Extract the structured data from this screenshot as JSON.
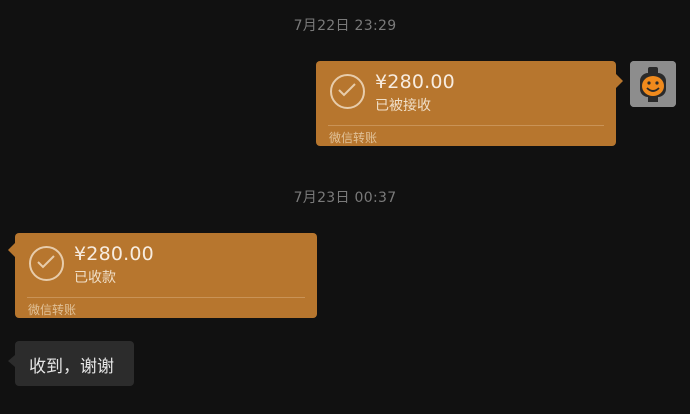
{
  "chat": {
    "timestamp_1": "7月22日 23:29",
    "timestamp_2": "7月23日 00:37",
    "sent_transfer": {
      "amount": "¥280.00",
      "status": "已被接收",
      "footer": "微信转账"
    },
    "received_transfer": {
      "amount": "¥280.00",
      "status": "已收款",
      "footer": "微信转账"
    },
    "text_message": "收到，谢谢"
  },
  "colors": {
    "background": "#111111",
    "transfer_bubble": "#b7762e",
    "text_bubble": "#2c2c2c"
  },
  "icons": {
    "check": "check-circle-icon",
    "avatar": "pumpkin-avatar"
  }
}
